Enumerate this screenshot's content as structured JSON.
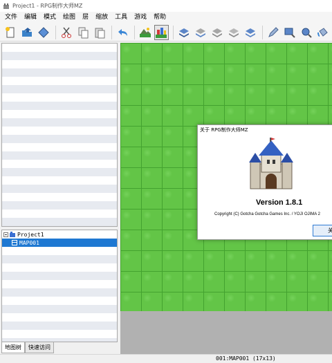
{
  "window": {
    "title": "Project1 - RPG制作大师MZ"
  },
  "menu": [
    "文件",
    "编辑",
    "模式",
    "绘图",
    "层",
    "缩放",
    "工具",
    "游戏",
    "帮助"
  ],
  "toolbar": {
    "icons": [
      "new-project-icon",
      "open-project-icon",
      "save-project-icon",
      "cut-icon",
      "copy-icon",
      "paste-icon",
      "undo-icon",
      "map-mode-icon",
      "event-mode-icon",
      "layer-a-icon",
      "layer-b-icon",
      "layer-c-icon",
      "layer-d-icon",
      "layer-auto-icon",
      "pencil-icon",
      "rectangle-icon",
      "ellipse-icon",
      "fill-icon"
    ]
  },
  "map_tree": {
    "project": "Project1",
    "maps": [
      {
        "label": "MAP001",
        "selected": true
      }
    ]
  },
  "tabs": [
    {
      "label": "地图树",
      "active": true
    },
    {
      "label": "快速访问",
      "active": false
    }
  ],
  "status": {
    "map_info": "001:MAP001 (17x13)"
  },
  "about_dialog": {
    "title": "关于 RPG制作大师MZ",
    "version": "Version 1.8.1",
    "copyright": "Copyright (C) Gotcha Gotcha Games Inc. / YOJI OJIMA 2",
    "close_label": "关"
  },
  "colors": {
    "grass": "#63c547",
    "selection": "#1e78d2",
    "map_bg": "#b1b1b1"
  }
}
